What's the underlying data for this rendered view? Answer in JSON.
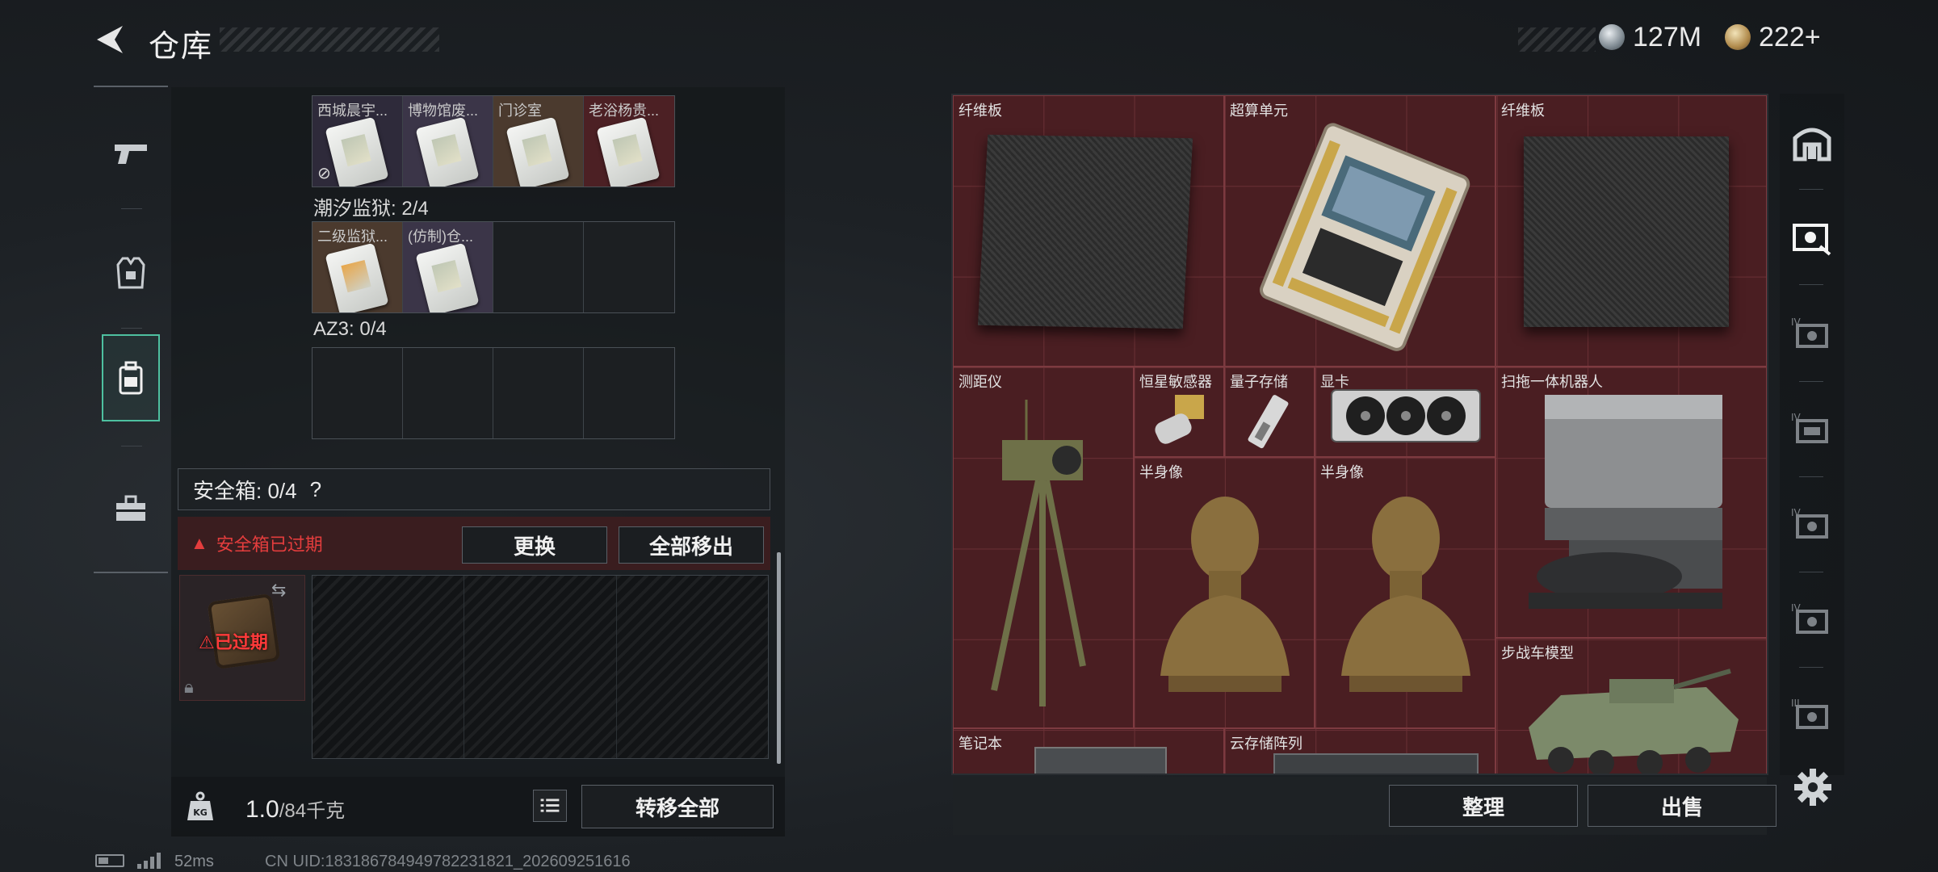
{
  "header": {
    "title": "仓库",
    "currency": [
      {
        "icon": "silver-coin-icon",
        "value": "127M"
      },
      {
        "icon": "gold-coin-icon",
        "value": "222+"
      }
    ]
  },
  "left_nav": [
    {
      "icon": "pistol-icon",
      "active": false
    },
    {
      "icon": "armor-vest-icon",
      "active": false
    },
    {
      "icon": "backpack-icon",
      "active": true
    },
    {
      "icon": "toolbox-icon",
      "active": false
    }
  ],
  "key_groups": [
    {
      "label": null,
      "slots": [
        "西城晨宇...",
        "博物馆废...",
        "门诊室",
        "老浴杨贵..."
      ]
    },
    {
      "label": "潮汐监狱: 2/4",
      "slots": [
        "二级监狱...",
        "(仿制)仓..."
      ]
    },
    {
      "label": "AZ3: 0/4",
      "slots": []
    }
  ],
  "safe_box": {
    "label": "安全箱: 0/4",
    "help": "?",
    "warning": "安全箱已过期",
    "replace_button": "更换",
    "remove_all_button": "全部移出",
    "case_status": "⚠已过期"
  },
  "inventory": {
    "weight": "1.0",
    "capacity": "/84千克",
    "transfer_button": "转移全部"
  },
  "status": {
    "ping": "52ms",
    "uid": "CN UID:18318678494978223182‌1_202609251616"
  },
  "stash": {
    "items": [
      {
        "name": "纤维板"
      },
      {
        "name": "超算单元"
      },
      {
        "name": "纤维板"
      },
      {
        "name": "测距仪"
      },
      {
        "name": "恒星敏感器"
      },
      {
        "name": "量子存储"
      },
      {
        "name": "显卡"
      },
      {
        "name": "扫拖一体机器人"
      },
      {
        "name": "半身像"
      },
      {
        "name": "半身像"
      },
      {
        "name": "步战车模型"
      },
      {
        "name": "笔记本"
      },
      {
        "name": "云存储阵列"
      }
    ],
    "tidy_button": "整理",
    "sell_button": "出售"
  },
  "right_sidebar": [
    {
      "icon": "stash-home-icon",
      "tier": ""
    },
    {
      "icon": "case-tier-icon",
      "tier": ""
    },
    {
      "icon": "case-tier-icon",
      "tier": "IV"
    },
    {
      "icon": "case-tier-icon",
      "tier": "IV"
    },
    {
      "icon": "case-tier-icon",
      "tier": "IV"
    },
    {
      "icon": "case-tier-icon",
      "tier": "IV"
    },
    {
      "icon": "case-tier-icon",
      "tier": "III"
    }
  ]
}
